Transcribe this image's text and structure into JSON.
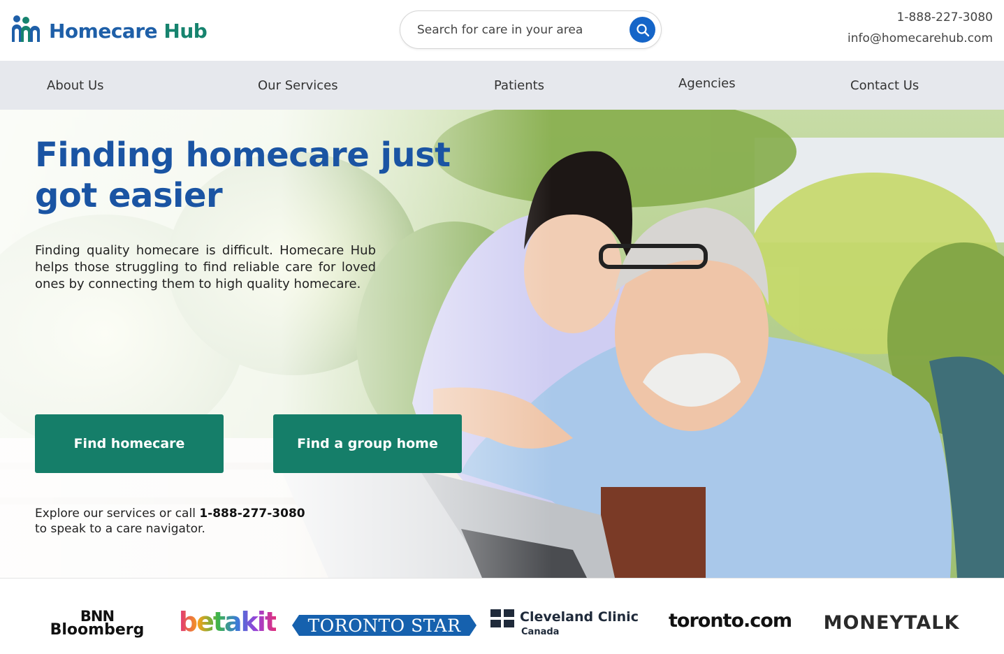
{
  "brand": {
    "name_part1": "Homecare",
    "name_part2": "Hub",
    "logo_icon": "homecare-hub-people-icon"
  },
  "search": {
    "placeholder": "Search for care in your area",
    "icon": "search-icon"
  },
  "contact": {
    "phone": "1-888-227-3080",
    "email": "info@homecarehub.com"
  },
  "nav": {
    "items": [
      {
        "label": "About Us"
      },
      {
        "label": "Our Services"
      },
      {
        "label": "Patients"
      },
      {
        "label": "Agencies"
      },
      {
        "label": "Contact Us"
      }
    ]
  },
  "hero": {
    "title_line1": "Finding homecare just",
    "title_line2": "got easier",
    "description": "Finding quality homecare is difficult. Homecare Hub helps those struggling to find reliable care for loved ones by connecting them to high quality homecare.",
    "cta_primary": "Find homecare",
    "cta_secondary": "Find a group home",
    "note_prefix": "Explore our services or call ",
    "note_phone": "1-888-277-3080",
    "note_suffix": "to speak to a care navigator."
  },
  "press": {
    "bnn_line1": "BNN",
    "bnn_line2": "Bloomberg",
    "betakit": "betakit",
    "toronto_star": "TORONTO STAR",
    "cleveland_line1": "Cleveland Clinic",
    "cleveland_line2": "Canada",
    "toronto_com": "toronto.com",
    "moneytalk": "MONEYTALK"
  },
  "colors": {
    "brand_blue": "#1a54a3",
    "brand_green": "#157e69",
    "search_blue": "#1565c8",
    "nav_bg": "#e6e8ed"
  }
}
